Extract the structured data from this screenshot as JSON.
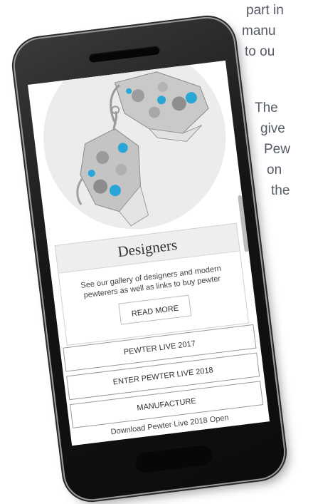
{
  "background_text": {
    "lines": [
      "part in",
      "manu",
      "to ou",
      "The",
      "give",
      "Pew",
      "on",
      "the"
    ]
  },
  "screen": {
    "card": {
      "title": "Designers",
      "description": "See our gallery of designers and modern pewterers as well as links to buy pewter",
      "read_more_label": "READ MORE"
    },
    "nav": {
      "items": [
        {
          "label": "PEWTER LIVE 2017"
        },
        {
          "label": "ENTER PEWTER LIVE 2018"
        },
        {
          "label": "MANUFACTURE"
        }
      ]
    },
    "footer": {
      "text": "Download Pewter Live 2018 Open"
    }
  },
  "colors": {
    "phone_body": "#141414",
    "screen_bg": "#ffffff",
    "card_header_bg": "#eeeeee",
    "gem": "#2aa6d6",
    "silver": "#c9c9c9"
  }
}
